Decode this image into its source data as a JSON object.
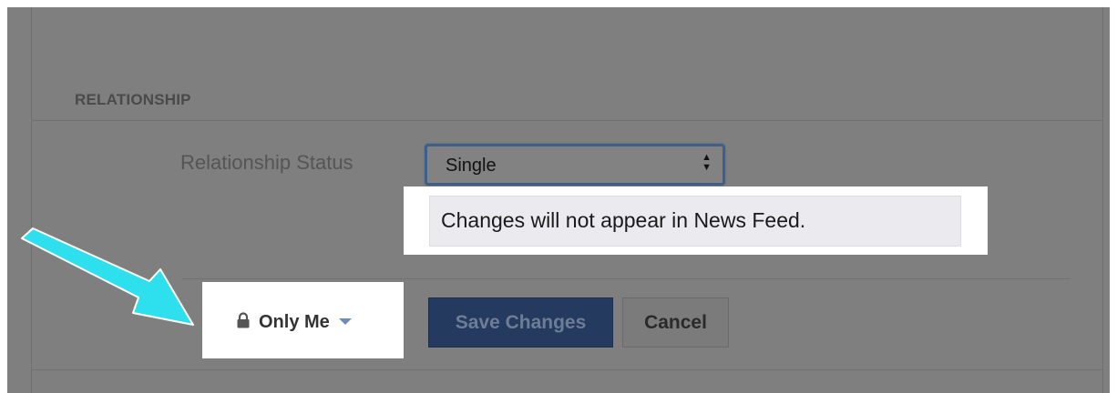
{
  "section": {
    "title": "RELATIONSHIP"
  },
  "field": {
    "label": "Relationship Status",
    "selected_value": "Single"
  },
  "tooltip": {
    "text": "Changes will not appear in News Feed."
  },
  "privacy": {
    "label": "Only Me",
    "icon": "lock-icon"
  },
  "actions": {
    "save_label": "Save Changes",
    "cancel_label": "Cancel"
  },
  "colors": {
    "overlay": "#7f7f7f",
    "arrow": "#2ee0ee",
    "save_button": "#243a5e",
    "select_focus": "#3f5f88"
  }
}
